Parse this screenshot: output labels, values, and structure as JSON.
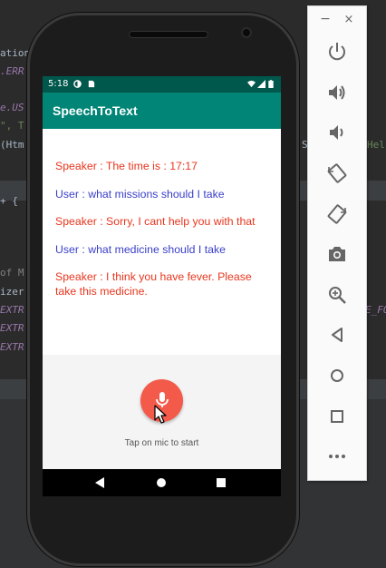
{
  "ide": {
    "lines": [
      {
        "text": "ation",
        "color": "#a9b7c6"
      },
      {
        "text": ".ERR",
        "color": "#9876aa"
      },
      {
        "text": "e.US",
        "color": "#9876aa"
      },
      {
        "text": "\", T",
        "color": "#6a8759"
      },
      {
        "text": "(Htm",
        "color": "#a9b7c6"
      },
      {
        "text": "+ {",
        "color": "#a9b7c6"
      },
      {
        "text": "of M",
        "color": "#808080"
      },
      {
        "text": "izer",
        "color": "#a9b7c6"
      },
      {
        "text": "EXTR",
        "color": "#9876aa"
      },
      {
        "text": "EXTR",
        "color": "#9876aa"
      },
      {
        "text": "EXTR",
        "color": "#9876aa"
      }
    ],
    "right_fragments": [
      "S",
      "Hel",
      "E_FO"
    ]
  },
  "phone": {
    "status_time": "5:18",
    "app_title": "SpeechToText",
    "messages": [
      {
        "role": "speaker",
        "text": "Speaker : The time is : 17:17"
      },
      {
        "role": "user",
        "text": "User : what missions should I take"
      },
      {
        "role": "speaker",
        "text": "Speaker : Sorry, I cant help you with that"
      },
      {
        "role": "user",
        "text": "User : what medicine should I take"
      },
      {
        "role": "speaker",
        "text": "Speaker : I think you have fever. Please take this medicine."
      }
    ],
    "mic_hint": "Tap on mic to start",
    "colors": {
      "statusbar": "#00574b",
      "appbar": "#008577",
      "speaker_text": "#e8361e",
      "user_text": "#3a3fc9",
      "mic_button": "#f45a4a"
    }
  },
  "panel": {
    "minimize_symbol": "−",
    "close_symbol": "×",
    "buttons": [
      "power-icon",
      "volume-up-icon",
      "volume-down-icon",
      "rotate-left-icon",
      "rotate-right-icon",
      "camera-icon",
      "zoom-icon",
      "back-icon",
      "home-icon",
      "overview-icon",
      "more-icon"
    ]
  }
}
